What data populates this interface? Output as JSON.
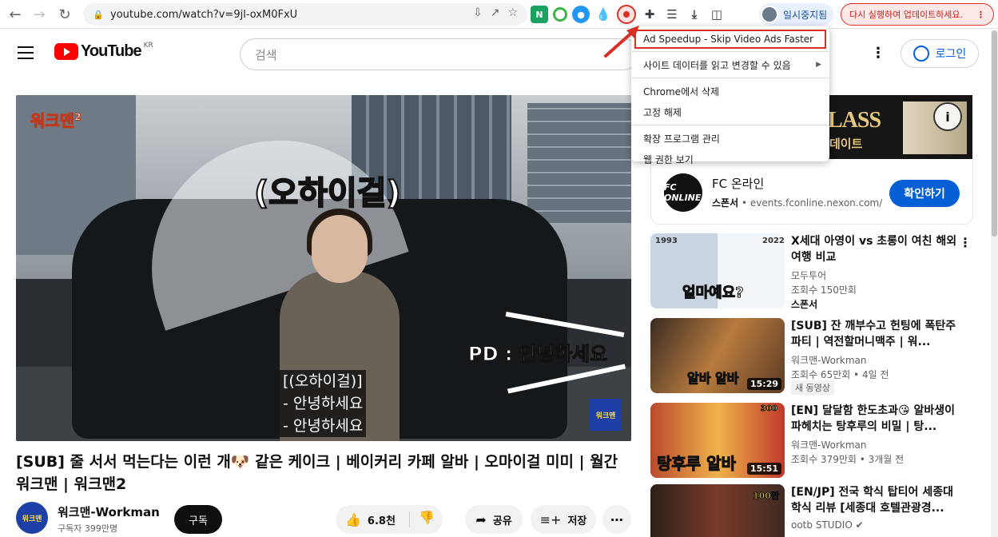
{
  "browser": {
    "url": "youtube.com/watch?v=9jl-oxM0FxU",
    "profile_label": "일시중지됨",
    "update_label": "다시 실행하여 업데이트하세요."
  },
  "header": {
    "logo_text": "YouTube",
    "region": "KR",
    "search_placeholder": "검색",
    "login_label": "로그인"
  },
  "video": {
    "channel_logo": "워크맨",
    "channel_logo_num": "2",
    "caption_main": "(오하이걸)",
    "caption_pd": "PD : 안녕하세요",
    "subtitles": [
      "[(오하이걸)]",
      "- 안녕하세요",
      "- 안녕하세요"
    ],
    "watermark": "워크맨",
    "title": "[SUB] 줄 서서 먹는다는 이런 개🐶 같은 케이크 | 베이커리 카페 알바 | 오마이걸 미미 | 월간워크맨 | 워크맨2"
  },
  "channel": {
    "avatar_text": "워크맨",
    "name": "워크맨-Workman",
    "subscribers": "구독자 399만명",
    "subscribe_label": "구독"
  },
  "actions": {
    "like_count": "6.8천",
    "share_label": "공유",
    "save_label": "저장"
  },
  "ad": {
    "banner_text": "LASS",
    "banner_sub": "데이트",
    "logo_text": "FC ONLINE",
    "title": "FC 온라인",
    "sponsor_label": "스폰서",
    "domain": "events.fconline.nexon.com/",
    "cta": "확인하기"
  },
  "recommendations": [
    {
      "title": "X세대 아영이 vs 초롱이 여친 해외여행 비교",
      "channel": "모두투어",
      "views": "조회수 150만회",
      "tag": "스폰서",
      "overlay": "얼마예요?",
      "corner_left": "1993",
      "corner_right": "2022"
    },
    {
      "title": "[SUB] 잔 깨부수고 헌팅에 폭탄주 파티 | 역전할머니맥주 | 워...",
      "channel": "워크맨-Workman",
      "views": "조회수 65만회 • 4일 전",
      "badge": "새 동영상",
      "duration": "15:29",
      "overlay": "알바 알바"
    },
    {
      "title": "[EN] 달달함 한도초과😘 알바생이 파헤치는 탕후루의 비밀 | 탕...",
      "channel": "워크맨-Workman",
      "views": "조회수 379만회 • 3개월 전",
      "duration": "15:51",
      "overlay": "탕후루 알바",
      "corner_right": "300"
    },
    {
      "title": "[EN/JP] 전국 학식 탑티어 세종대 학식 리뷰 [세종대 호텔관광경...",
      "channel": "ootb STUDIO ✔",
      "corner_right": "100만"
    }
  ],
  "context_menu": {
    "items": [
      "Ad Speedup - Skip Video Ads Faster",
      "사이트 데이터를 읽고 변경할 수 있음",
      "Chrome에서 삭제",
      "고정 해제",
      "확장 프로그램 관리",
      "웹 권한 보기"
    ]
  },
  "colors": {
    "yt_red": "#ff0000",
    "link_blue": "#065fd4",
    "highlight_red": "#d93025"
  }
}
